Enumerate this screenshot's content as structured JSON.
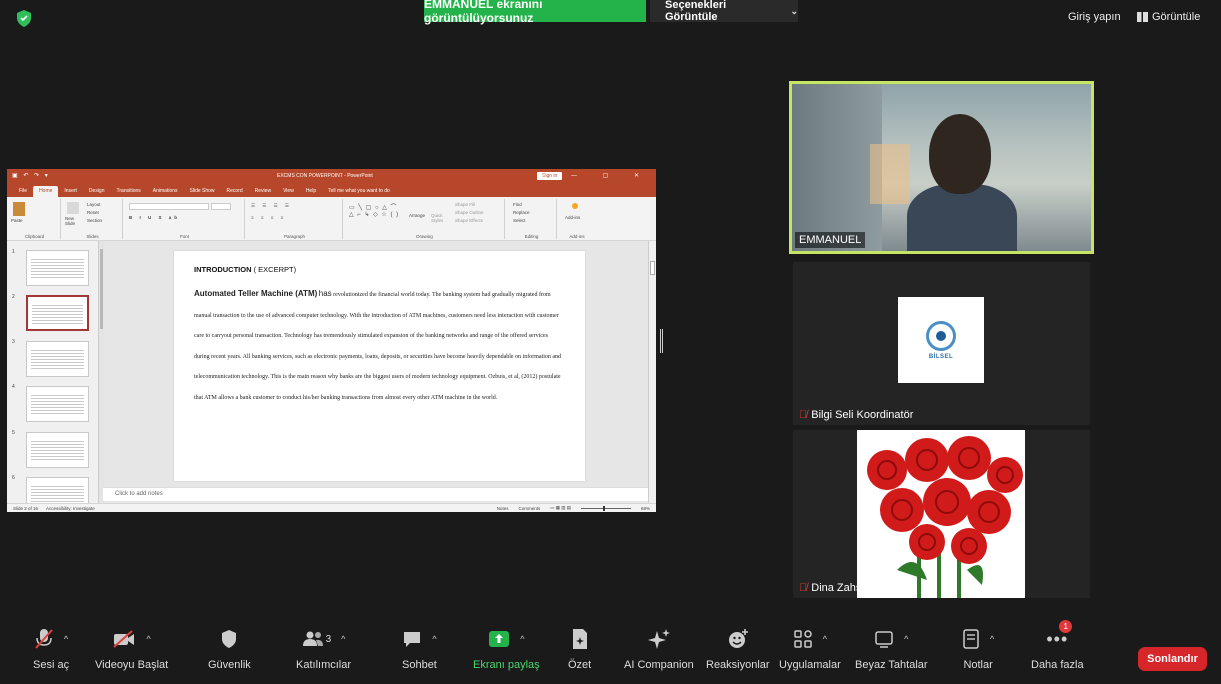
{
  "top_bar": {
    "share_banner": "EMMANUEL ekranını görüntülüyorsunuz",
    "view_options": "Seçenekleri Görüntüle",
    "sign_in": "Giriş yapın",
    "view_label": "Görüntüle"
  },
  "powerpoint": {
    "doc_title": "EXCMS CON POWERPOINT - PowerPoint",
    "sign_in": "Sign in",
    "menu": [
      "File",
      "Home",
      "Insert",
      "Design",
      "Transitions",
      "Animations",
      "Slide Show",
      "Record",
      "Review",
      "View",
      "Help",
      "Tell me what you want to do"
    ],
    "ribbon_groups": [
      "Clipboard",
      "Slides",
      "Font",
      "Paragraph",
      "Drawing",
      "Editing",
      "Add-ins"
    ],
    "ribbon_buttons": {
      "paste": "Paste",
      "new_slide": "New Slide",
      "layout": "Layout",
      "reset": "Reset",
      "section": "Section",
      "arrange": "Arrange",
      "quick_styles": "Quick Styles",
      "shape_fill": "Shape Fill",
      "shape_outline": "Shape Outline",
      "shape_effects": "Shape Effects",
      "find": "Find",
      "replace": "Replace",
      "select": "Select",
      "add_ins": "Add-ins"
    },
    "thumbnails": [
      "1",
      "2",
      "3",
      "4",
      "5",
      "6"
    ],
    "slide": {
      "title": "INTRODUCTION",
      "title_suffix": "( EXCERPT)",
      "lead": "Automated Teller Machine (ATM)",
      "lead_rest": "has",
      "body": "revolutionized the financial world today. The banking system had gradually migrated from manual transaction to the use of advanced computer technology. With the introduction of ATM machines, customers need less interaction with customer care to carryout personal transaction. Technology has tremendously stimulated expansion of the banking networks and range of the offered services during recent years. All banking services, such as electronic payments, loans, deposits, or securities have become heavily dependable on information and telecommunication technology. This is the main reason why banks are the biggest users of modern technology equipment. Ozbuis, et al, (2012) postulate that ATM allows a bank customer to conduct his/her banking transactions from almost every other ATM machine in the world."
    },
    "notes_placeholder": "Click to add notes",
    "status": {
      "slide_count": "Slide 2 of 16",
      "accessibility": "Accessibility: Investigate",
      "notes": "Notes",
      "comments": "Comments",
      "zoom": "68%"
    }
  },
  "participants": {
    "active": "EMMANUEL",
    "bilsel": "Bilgi Seli Koordinatör",
    "bilsel_logo": "BİLSEL",
    "dina": "Dina Zahşan"
  },
  "toolbar": {
    "mute": "Sesi aç",
    "video": "Videoyu Başlat",
    "security": "Güvenlik",
    "participants": "Katılımcılar",
    "participants_count": "3",
    "chat": "Sohbet",
    "share": "Ekranı paylaş",
    "summary": "Özet",
    "ai": "AI Companion",
    "reactions": "Reaksiyonlar",
    "apps": "Uygulamalar",
    "whiteboard": "Beyaz Tahtalar",
    "notes": "Notlar",
    "more": "Daha fazla",
    "more_badge": "1",
    "end": "Sonlandır"
  },
  "colors": {
    "share_green": "#23b34a",
    "ppt_red": "#b7472a",
    "active_border": "#c7e565",
    "end_red": "#d6262a"
  }
}
